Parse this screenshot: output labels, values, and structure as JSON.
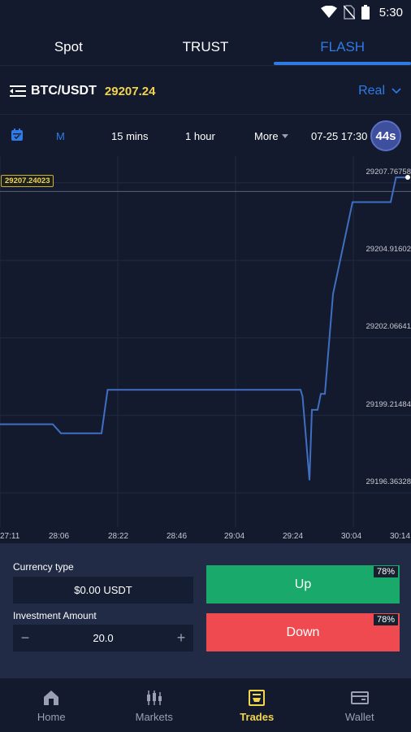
{
  "status_bar": {
    "time": "5:30"
  },
  "tabs": [
    {
      "label": "Spot",
      "active": false
    },
    {
      "label": "TRUST",
      "active": false
    },
    {
      "label": "FLASH",
      "active": true
    }
  ],
  "pair": {
    "name": "BTC/USDT",
    "price": "29207.24",
    "mode": "Real"
  },
  "intervals": {
    "m_label": "M",
    "fifteen_label": "15 mins",
    "hour_label": "1 hour",
    "more_label": "More",
    "date_time": "07-25 17:30",
    "countdown": "44s"
  },
  "chart_data": {
    "type": "line",
    "current_price_tag": "29207.24023",
    "y_ticks": [
      "29207.76758",
      "29204.91602",
      "29202.06641",
      "29199.21484",
      "29196.36328"
    ],
    "x_ticks": [
      "27:11",
      "28:06",
      "28:22",
      "28:46",
      "29:04",
      "29:24",
      "30:04",
      "30:14"
    ],
    "ylim": [
      29194.9,
      29208.3
    ],
    "x": [
      0,
      0.13,
      0.15,
      0.25,
      0.265,
      0.74,
      0.745,
      0.762,
      0.768,
      0.782,
      0.79,
      0.8,
      0.82,
      0.868,
      0.962,
      0.975,
      1.0
    ],
    "values": [
      29198.68,
      29198.68,
      29198.35,
      29198.35,
      29199.95,
      29199.95,
      29199.7,
      29196.62,
      29199.21,
      29199.21,
      29199.8,
      29199.8,
      29203.47,
      29206.85,
      29206.85,
      29207.76,
      29207.76
    ],
    "line_color": "#3f6fc2",
    "grid": true
  },
  "order": {
    "currency_label": "Currency type",
    "currency_value": "$0.00 USDT",
    "amount_label": "Investment Amount",
    "amount_value": "20.0",
    "minus": "−",
    "plus": "+",
    "up_label": "Up",
    "up_pct": "78%",
    "down_label": "Down",
    "down_pct": "78%",
    "up_color": "#19a96a",
    "down_color": "#ef4a4f"
  },
  "nav": [
    {
      "label": "Home",
      "icon": "home-icon",
      "active": false
    },
    {
      "label": "Markets",
      "icon": "markets-icon",
      "active": false
    },
    {
      "label": "Trades",
      "icon": "trades-icon",
      "active": true
    },
    {
      "label": "Wallet",
      "icon": "wallet-icon",
      "active": false
    }
  ]
}
